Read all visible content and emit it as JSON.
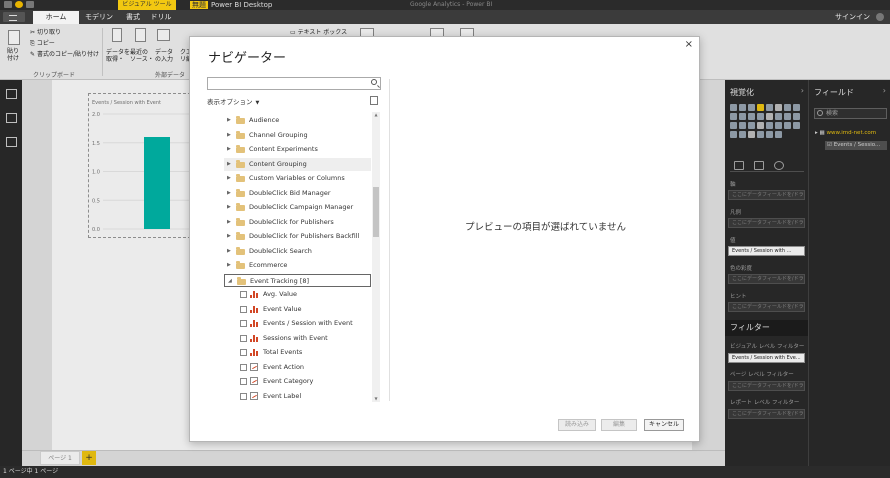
{
  "titlebar": {
    "context_tab": "ビジュアル ツール",
    "label": "無題",
    "title": "Power BI Desktop",
    "faint_title": "Google Analytics - Power BI"
  },
  "tabs": {
    "home": "ホーム",
    "modeling": "モデリング",
    "format": "書式",
    "drill": "ドリル",
    "signin": "サインイン"
  },
  "ribbon": {
    "paste": "貼り\n付け",
    "cut": "切り取り",
    "copy": "コピー",
    "format_painter": "書式のコピー/貼り付け",
    "clipboard_group": "クリップボード",
    "get_data": "データを\n取得・",
    "recent_sources": "最近の\nソース・",
    "enter_data": "データ\nの入力",
    "edit_queries": "クエ\nリ編",
    "external_data_group": "外部データ",
    "textbox": "テキスト ボックス"
  },
  "visual": {
    "title": "Events / Session with Event",
    "y_ticks": [
      "2.0",
      "1.5",
      "1.0",
      "0.5",
      "0.0"
    ]
  },
  "chart_data": {
    "type": "bar",
    "title": "Events / Session with Event",
    "categories": [
      ""
    ],
    "values": [
      1.6
    ],
    "ylim": [
      0,
      2.0
    ],
    "grid": true
  },
  "pagebar": {
    "page_tab": "ページ 1",
    "add": "+"
  },
  "status": {
    "text": "1 ページ中 1 ページ"
  },
  "vispane": {
    "header": "視覚化",
    "wells": [
      {
        "label": "軸",
        "value": "ここにデータフィールドを/ドラ"
      },
      {
        "label": "凡例",
        "value": "ここにデータフィールドを/ドラ"
      },
      {
        "label": "値",
        "value": "Events / Session with ...",
        "filled": true
      },
      {
        "label": "色の彩度",
        "value": "ここにデータフィールドを/ドラ"
      },
      {
        "label": "ヒント",
        "value": "ここにデータフィールドを/ドラ"
      }
    ],
    "filter_header": "フィルター",
    "filters": [
      {
        "label": "ビジュアル レベル フィルター",
        "value": "Events / Session with Eve...",
        "filled": true
      },
      {
        "label": "ページ レベル フィルター",
        "value": "ここにデータフィールドを/ドラ"
      },
      {
        "label": "レポート レベル フィルター",
        "value": "ここにデータフィールドを/ドラ"
      }
    ]
  },
  "fieldpane": {
    "header": "フィールド",
    "search_placeholder": "検索",
    "table": "www.imd-net.com",
    "field": "Events / Sessio..."
  },
  "navigator": {
    "title": "ナビゲーター",
    "close": "×",
    "display_options": "表示オプション",
    "preview_message": "プレビューの項目が選ばれていません",
    "folders": [
      "Audience",
      "Channel Grouping",
      "Content Experiments",
      "Content Grouping",
      "Custom Variables or Columns",
      "DoubleClick Bid Manager",
      "DoubleClick Campaign Manager",
      "DoubleClick for Publishers",
      "DoubleClick for Publishers Backfill",
      "DoubleClick Search",
      "Ecommerce"
    ],
    "open_folder": "Event Tracking [8]",
    "leaves": [
      {
        "label": "Avg. Value",
        "icon": "measure"
      },
      {
        "label": "Event Value",
        "icon": "measure"
      },
      {
        "label": "Events / Session with Event",
        "icon": "measure"
      },
      {
        "label": "Sessions with Event",
        "icon": "measure"
      },
      {
        "label": "Total Events",
        "icon": "measure"
      },
      {
        "label": "Event Action",
        "icon": "dimension"
      },
      {
        "label": "Event Category",
        "icon": "dimension"
      },
      {
        "label": "Event Label",
        "icon": "dimension"
      }
    ],
    "buttons": {
      "load": "読み込み",
      "edit": "編集",
      "cancel": "キャンセル"
    }
  }
}
